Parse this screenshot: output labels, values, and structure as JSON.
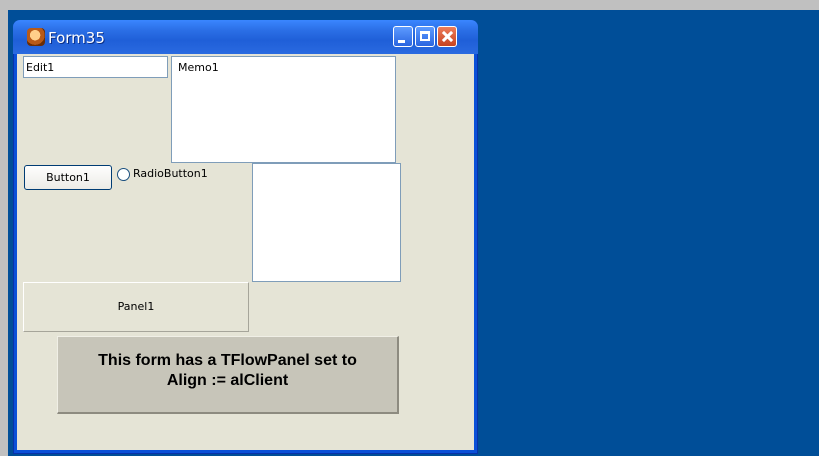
{
  "window": {
    "title": "Form35"
  },
  "form": {
    "edit1_value": "Edit1",
    "memo1_text": "Memo1",
    "button1_label": "Button1",
    "radio1_label": "RadioButton1",
    "panel1_caption": "Panel1",
    "note_line1": "This form has a TFlowPanel set to",
    "note_line2": "Align := alClient"
  },
  "colors": {
    "desktop": "#004e98",
    "titlebar": "#2b6fe6",
    "client": "#e5e4d6",
    "close_button": "#c6421f"
  },
  "icons": [
    "app-icon",
    "minimize-icon",
    "maximize-icon",
    "close-icon"
  ]
}
